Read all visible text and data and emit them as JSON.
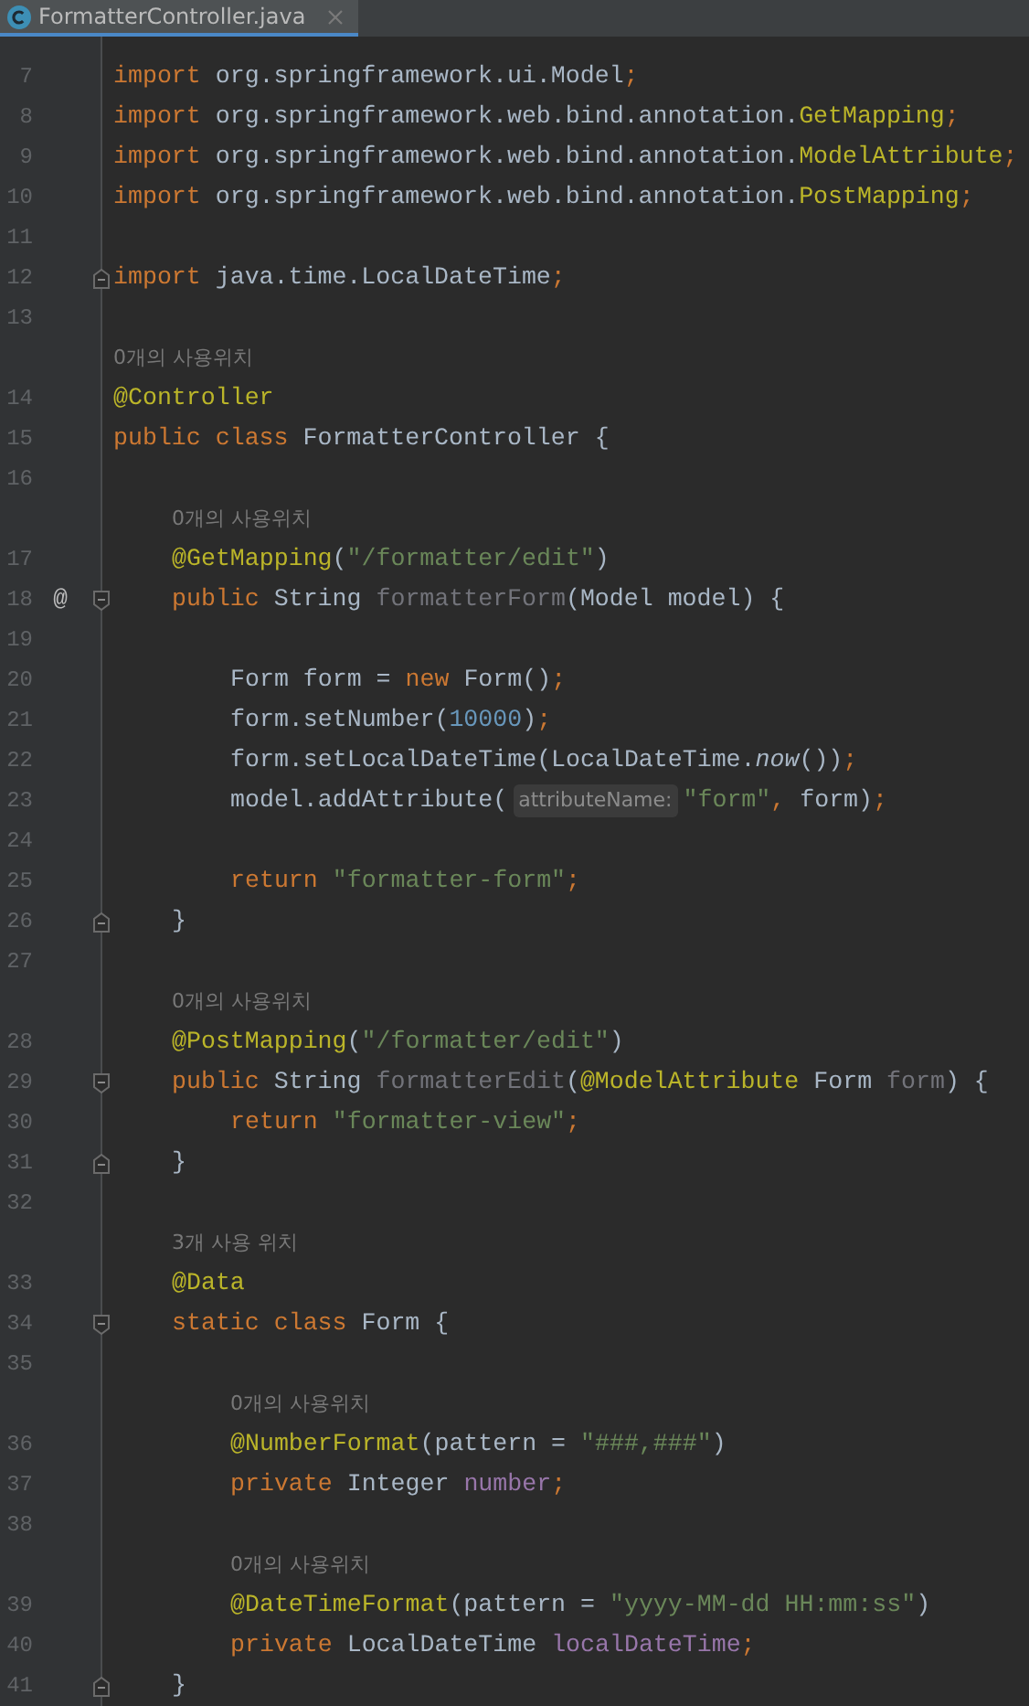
{
  "tabs": [
    {
      "label": "FormatterController.java",
      "selected": true
    }
  ],
  "lines": [
    {
      "number": "7",
      "tokens": [
        {
          "kind": "kw",
          "t": "import"
        },
        {
          "kind": "plain",
          "t": " org.springframework.ui.Model"
        },
        {
          "kind": "kw",
          "t": ";"
        }
      ]
    },
    {
      "number": "8",
      "tokens": [
        {
          "kind": "kw",
          "t": "import"
        },
        {
          "kind": "plain",
          "t": " org.springframework.web.bind.annotation."
        },
        {
          "kind": "ann",
          "t": "GetMapping"
        },
        {
          "kind": "kw",
          "t": ";"
        }
      ]
    },
    {
      "number": "9",
      "tokens": [
        {
          "kind": "kw",
          "t": "import"
        },
        {
          "kind": "plain",
          "t": " org.springframework.web.bind.annotation."
        },
        {
          "kind": "ann",
          "t": "ModelAttribute"
        },
        {
          "kind": "kw",
          "t": ";"
        }
      ]
    },
    {
      "number": "10",
      "tokens": [
        {
          "kind": "kw",
          "t": "import"
        },
        {
          "kind": "plain",
          "t": " org.springframework.web.bind.annotation."
        },
        {
          "kind": "ann",
          "t": "PostMapping"
        },
        {
          "kind": "kw",
          "t": ";"
        }
      ]
    },
    {
      "number": "11"
    },
    {
      "number": "12",
      "fold_end": true,
      "tokens": [
        {
          "kind": "kw",
          "t": "import"
        },
        {
          "kind": "plain",
          "t": " java.time.LocalDateTime"
        },
        {
          "kind": "kw",
          "t": ";"
        }
      ]
    },
    {
      "number": "13"
    },
    {
      "number": "14",
      "hint": "0개의 사용위치",
      "tokens": [
        {
          "kind": "ann",
          "t": "@Controller"
        }
      ]
    },
    {
      "number": "15",
      "tokens": [
        {
          "kind": "kw",
          "t": "public class"
        },
        {
          "kind": "plain",
          "t": " FormatterController {"
        }
      ],
      "children": [
        {
          "number": "16"
        },
        {
          "number": "17",
          "hint": "0개의 사용위치",
          "tokens": [
            {
              "kind": "ann",
              "t": "@GetMapping"
            },
            {
              "kind": "plain",
              "t": "("
            },
            {
              "kind": "str",
              "t": "\"/formatter/edit\""
            },
            {
              "kind": "plain",
              "t": ")"
            }
          ]
        },
        {
          "number": "18",
          "marker": "@",
          "fold_start": true,
          "tokens": [
            {
              "kind": "kw",
              "t": "public"
            },
            {
              "kind": "plain",
              "t": " String "
            },
            {
              "kind": "unused",
              "t": "formatterForm"
            },
            {
              "kind": "plain",
              "t": "(Model model) {"
            }
          ],
          "children": [
            {
              "number": "19"
            },
            {
              "number": "20",
              "tokens": [
                {
                  "kind": "plain",
                  "t": "Form form = "
                },
                {
                  "kind": "kw",
                  "t": "new"
                },
                {
                  "kind": "plain",
                  "t": " Form()"
                },
                {
                  "kind": "kw",
                  "t": ";"
                }
              ]
            },
            {
              "number": "21",
              "tokens": [
                {
                  "kind": "plain",
                  "t": "form.setNumber("
                },
                {
                  "kind": "num",
                  "t": "10000"
                },
                {
                  "kind": "plain",
                  "t": ")"
                },
                {
                  "kind": "kw",
                  "t": ";"
                }
              ]
            },
            {
              "number": "22",
              "tokens": [
                {
                  "kind": "plain",
                  "t": "form.setLocalDateTime(LocalDateTime."
                },
                {
                  "kind": "static",
                  "t": "now"
                },
                {
                  "kind": "plain",
                  "t": "())"
                },
                {
                  "kind": "kw",
                  "t": ";"
                }
              ]
            },
            {
              "number": "23",
              "tokens": [
                {
                  "kind": "plain",
                  "t": "model.addAttribute("
                },
                {
                  "kind": "inlay",
                  "t": "attributeName:"
                },
                {
                  "kind": "str",
                  "t": "\"form\""
                },
                {
                  "kind": "kw",
                  "t": ","
                },
                {
                  "kind": "plain",
                  "t": " form)"
                },
                {
                  "kind": "kw",
                  "t": ";"
                }
              ]
            },
            {
              "number": "24"
            },
            {
              "number": "25",
              "tokens": [
                {
                  "kind": "kw",
                  "t": "return"
                },
                {
                  "kind": "str",
                  "t": " \"formatter-form\""
                },
                {
                  "kind": "kw",
                  "t": ";"
                }
              ]
            }
          ]
        },
        {
          "number": "26",
          "fold_end": true,
          "tokens": [
            {
              "kind": "plain",
              "t": "}"
            }
          ]
        },
        {
          "number": "27"
        },
        {
          "number": "28",
          "hint": "0개의 사용위치",
          "tokens": [
            {
              "kind": "ann",
              "t": "@PostMapping"
            },
            {
              "kind": "plain",
              "t": "("
            },
            {
              "kind": "str",
              "t": "\"/formatter/edit\""
            },
            {
              "kind": "plain",
              "t": ")"
            }
          ]
        },
        {
          "number": "29",
          "fold_start": true,
          "tokens": [
            {
              "kind": "kw",
              "t": "public"
            },
            {
              "kind": "plain",
              "t": " String "
            },
            {
              "kind": "unused",
              "t": "formatterEdit"
            },
            {
              "kind": "plain",
              "t": "("
            },
            {
              "kind": "ann",
              "t": "@ModelAttribute"
            },
            {
              "kind": "plain",
              "t": " Form "
            },
            {
              "kind": "unused",
              "t": "form"
            },
            {
              "kind": "plain",
              "t": ") {"
            }
          ],
          "children": [
            {
              "number": "30",
              "tokens": [
                {
                  "kind": "kw",
                  "t": "return"
                },
                {
                  "kind": "str",
                  "t": " \"formatter-view\""
                },
                {
                  "kind": "kw",
                  "t": ";"
                }
              ]
            }
          ]
        },
        {
          "number": "31",
          "fold_end": true,
          "tokens": [
            {
              "kind": "plain",
              "t": "}"
            }
          ]
        },
        {
          "number": "32"
        },
        {
          "number": "33",
          "hint": "3개 사용 위치",
          "tokens": [
            {
              "kind": "ann",
              "t": "@Data"
            }
          ]
        },
        {
          "number": "34",
          "fold_start": true,
          "tokens": [
            {
              "kind": "kw",
              "t": "static class"
            },
            {
              "kind": "plain",
              "t": " Form {"
            }
          ],
          "children": [
            {
              "number": "35"
            },
            {
              "number": "36",
              "hint": "0개의 사용위치",
              "tokens": [
                {
                  "kind": "ann",
                  "t": "@NumberFormat"
                },
                {
                  "kind": "plain",
                  "t": "(pattern = "
                },
                {
                  "kind": "str",
                  "t": "\"###,###\""
                },
                {
                  "kind": "plain",
                  "t": ")"
                }
              ]
            },
            {
              "number": "37",
              "tokens": [
                {
                  "kind": "kw",
                  "t": "private"
                },
                {
                  "kind": "plain",
                  "t": " Integer "
                },
                {
                  "kind": "field",
                  "t": "number"
                },
                {
                  "kind": "kw",
                  "t": ";"
                }
              ]
            },
            {
              "number": "38"
            },
            {
              "number": "39",
              "hint": "0개의 사용위치",
              "tokens": [
                {
                  "kind": "ann",
                  "t": "@DateTimeFormat"
                },
                {
                  "kind": "plain",
                  "t": "(pattern = "
                },
                {
                  "kind": "str",
                  "t": "\"yyyy-MM-dd HH:mm:ss\""
                },
                {
                  "kind": "plain",
                  "t": ")"
                }
              ]
            },
            {
              "number": "40",
              "tokens": [
                {
                  "kind": "kw",
                  "t": "private"
                },
                {
                  "kind": "plain",
                  "t": " LocalDateTime "
                },
                {
                  "kind": "field",
                  "t": "localDateTime"
                },
                {
                  "kind": "kw",
                  "t": ";"
                }
              ]
            }
          ]
        },
        {
          "number": "41",
          "fold_end": true,
          "tokens": [
            {
              "kind": "plain",
              "t": "}"
            }
          ]
        }
      ]
    }
  ]
}
